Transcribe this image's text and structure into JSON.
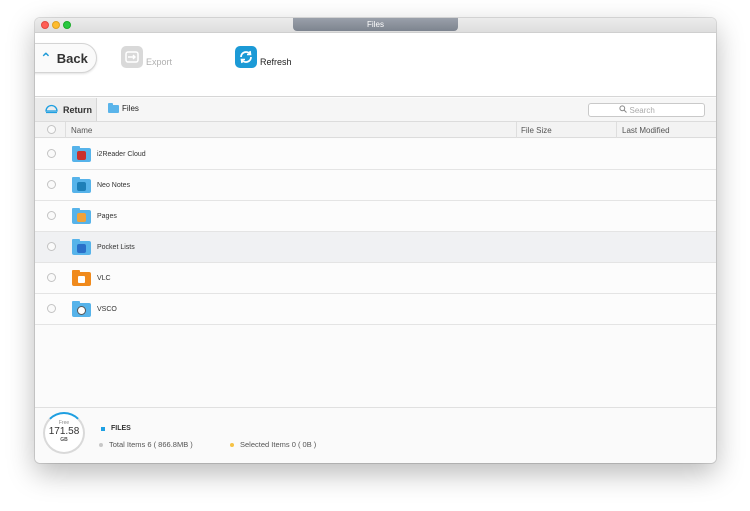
{
  "window": {
    "title": "Files"
  },
  "toolbar": {
    "back_label": "Back",
    "export_label": "Export",
    "refresh_label": "Refresh"
  },
  "nav": {
    "return_label": "Return",
    "breadcrumb": "Files",
    "search_placeholder": "Search"
  },
  "table": {
    "columns": {
      "name": "Name",
      "size": "File Size",
      "modified": "Last Modified"
    },
    "rows": [
      {
        "name": "i2Reader Cloud",
        "icon": "i2reader-cloud-icon",
        "color": "#c9302c"
      },
      {
        "name": "Neo Notes",
        "icon": "neo-notes-icon",
        "color": "#1d7fb8"
      },
      {
        "name": "Pages",
        "icon": "pages-icon",
        "color": "#f0a23a"
      },
      {
        "name": "Pocket Lists",
        "icon": "pocket-lists-icon",
        "color": "#2a6fc9"
      },
      {
        "name": "VLC",
        "icon": "vlc-icon",
        "color": "#f08a1c"
      },
      {
        "name": "VSCO",
        "icon": "vsco-icon",
        "color": "#ffffff"
      }
    ]
  },
  "footer": {
    "free_label": "Free",
    "free_value": "171.58",
    "free_unit": "GB",
    "section_title": "FILES",
    "total_items": "Total Items 6 ( 866.8MB )",
    "selected_items": "Selected Items 0 ( 0B )"
  },
  "colors": {
    "accent": "#1e9fe1",
    "folder": "#56b3ea",
    "selected_dot": "#f6c245"
  }
}
